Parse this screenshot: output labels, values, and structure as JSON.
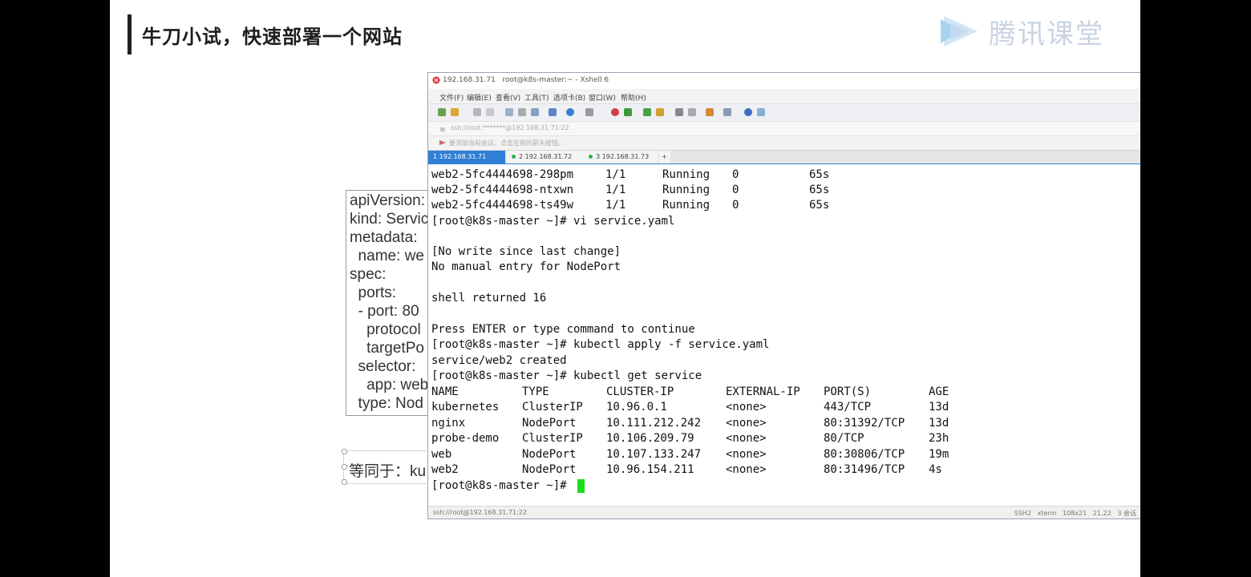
{
  "slide": {
    "title": "牛刀小试，快速部署一个网站",
    "brand": "腾讯课堂",
    "yaml_lines": [
      "apiVersion:",
      "kind: Servic",
      "metadata:",
      "  name: we",
      "spec:",
      "  ports:",
      "  - port: 80",
      "    protocol",
      "    targetPo",
      "  selector:",
      "    app: web",
      "  type: Nod"
    ],
    "equivalent_text": "等同于：ku"
  },
  "window": {
    "title": "192.168.31.71   root@k8s-master:~ - Xshell 6",
    "menus": [
      "文件(F)",
      "编辑(E)",
      "查看(V)",
      "工具(T)",
      "选项卡(B)",
      "窗口(W)",
      "帮助(H)"
    ],
    "address": "ssh://root:*******@192.168.31.71:22",
    "hint": "要添加当前会话，点击左侧的箭头按钮。",
    "tabs": [
      {
        "label": "1 192.168.31.71",
        "active": true
      },
      {
        "label": "2 192.168.31.72",
        "active": false
      },
      {
        "label": "3 192.168.31.73",
        "active": false
      }
    ],
    "add_tab": "+",
    "status_left": "ssh://root@192.168.31.71:22",
    "status_right": "SSH2   xterm   108x21   21,22   3 会话"
  },
  "terminal": {
    "pod_rows": [
      [
        "web2-5fc4444698-298pm",
        "1/1",
        "Running",
        "0",
        "65s"
      ],
      [
        "web2-5fc4444698-ntxwn",
        "1/1",
        "Running",
        "0",
        "65s"
      ],
      [
        "web2-5fc4444698-ts49w",
        "1/1",
        "Running",
        "0",
        "65s"
      ]
    ],
    "cmd_vi": "[root@k8s-master ~]# vi service.yaml",
    "no_write": "[No write since last change]",
    "no_manual": "No manual entry for NodePort",
    "shell_returned": "shell returned 16",
    "press_enter": "Press ENTER or type command to continue",
    "cmd_apply": "[root@k8s-master ~]# kubectl apply -f service.yaml",
    "created": "service/web2 created",
    "cmd_get": "[root@k8s-master ~]# kubectl get service",
    "service_header": [
      "NAME",
      "TYPE",
      "CLUSTER-IP",
      "EXTERNAL-IP",
      "PORT(S)",
      "AGE"
    ],
    "service_rows": [
      [
        "kubernetes",
        "ClusterIP",
        "10.96.0.1",
        "<none>",
        "443/TCP",
        "13d"
      ],
      [
        "nginx",
        "NodePort",
        "10.111.212.242",
        "<none>",
        "80:31392/TCP",
        "13d"
      ],
      [
        "probe-demo",
        "ClusterIP",
        "10.106.209.79",
        "<none>",
        "80/TCP",
        "23h"
      ],
      [
        "web",
        "NodePort",
        "10.107.133.247",
        "<none>",
        "80:30806/TCP",
        "19m"
      ],
      [
        "web2",
        "NodePort",
        "10.96.154.211",
        "<none>",
        "80:31496/TCP",
        "4s"
      ]
    ],
    "prompt": "[root@k8s-master ~]#"
  },
  "colors": {
    "cursor": "#1cdc1c",
    "tab_active": "#2f7fd6",
    "brand": "#c9d3e3"
  }
}
